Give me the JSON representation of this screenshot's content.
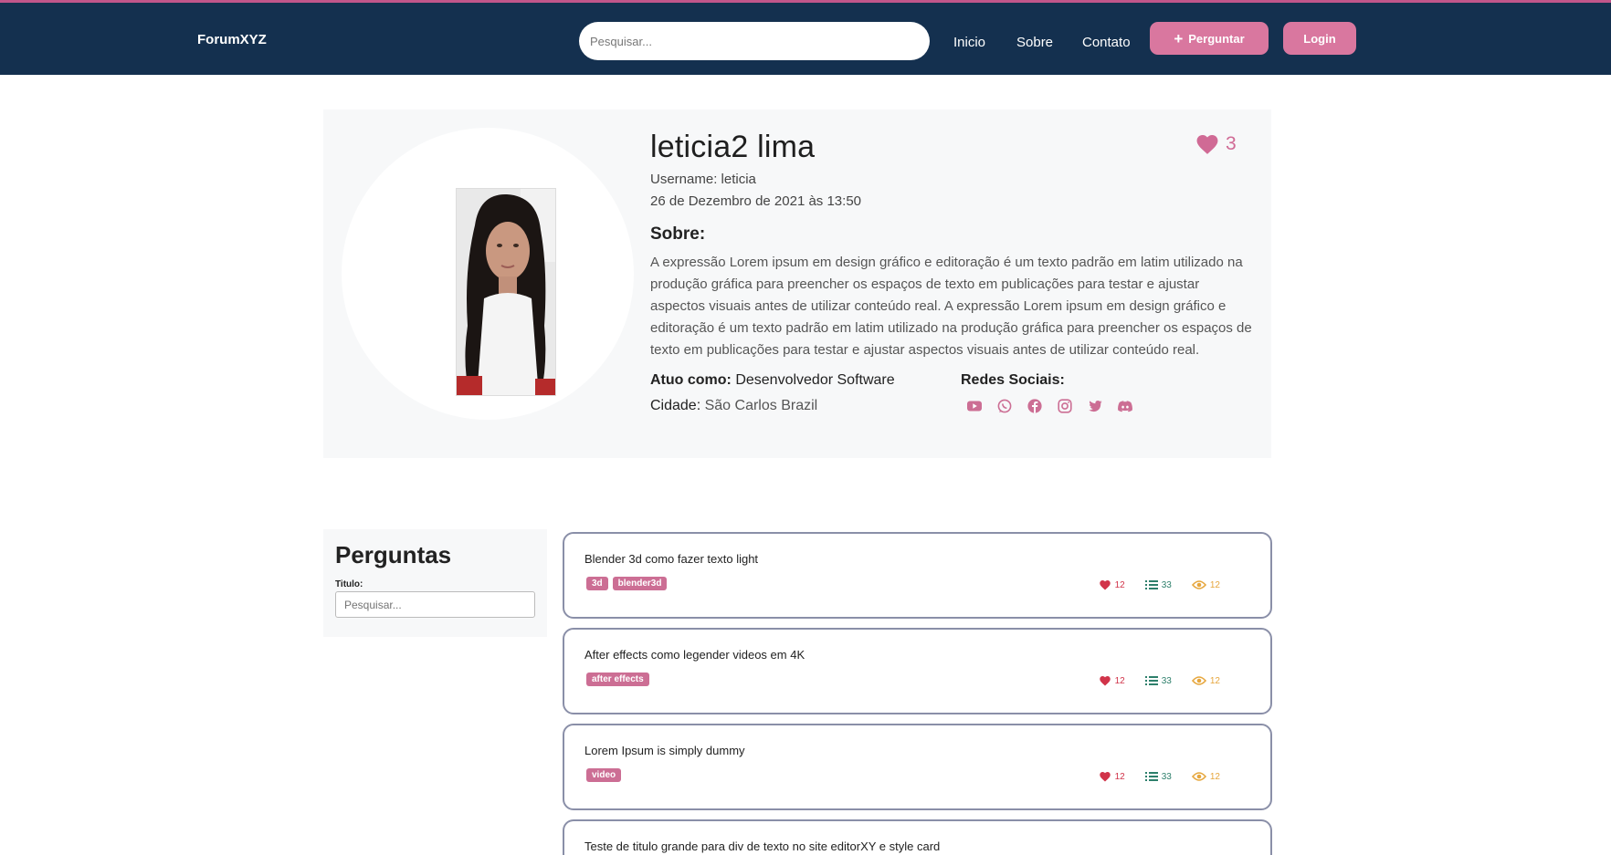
{
  "nav": {
    "brand": "ForumXYZ",
    "search_placeholder": "Pesquisar...",
    "links": [
      "Inicio",
      "Sobre",
      "Contato"
    ],
    "ask_button": "Perguntar",
    "login_button": "Login"
  },
  "profile": {
    "name": "leticia2 lima",
    "username": "Username: leticia",
    "date": "26 de Dezembro de 2021 às 13:50",
    "about_heading": "Sobre:",
    "about_text": "A expressão Lorem ipsum em design gráfico e editoração é um texto padrão em latim utilizado na produção gráfica para preencher os espaços de texto em publicações para testar e ajustar aspectos visuais antes de utilizar conteúdo real. A expressão Lorem ipsum em design gráfico e editoração é um texto padrão em latim utilizado na produção gráfica para preencher os espaços de texto em publicações para testar e ajustar aspectos visuais antes de utilizar conteúdo real.",
    "role_label": "Atuo como:",
    "role_value": "Desenvolvedor Software",
    "city_label": "Cidade:",
    "city_value": "São Carlos Brazil",
    "social_heading": "Redes Sociais:",
    "likes": "3",
    "social_icons": [
      "youtube-icon",
      "whatsapp-icon",
      "facebook-icon",
      "instagram-icon",
      "twitter-icon",
      "discord-icon"
    ]
  },
  "sidebar": {
    "title": "Perguntas",
    "field_label": "Titulo:",
    "search_placeholder": "Pesquisar..."
  },
  "questions": [
    {
      "title": "Blender 3d como fazer texto light",
      "tags": [
        "3d",
        "blender3d"
      ],
      "likes": "12",
      "answers": "33",
      "views": "12"
    },
    {
      "title": "After effects como legender videos em 4K",
      "tags": [
        "after effects"
      ],
      "likes": "12",
      "answers": "33",
      "views": "12"
    },
    {
      "title": "Lorem Ipsum is simply dummy",
      "tags": [
        "video"
      ],
      "likes": "12",
      "answers": "33",
      "views": "12"
    },
    {
      "title": "Teste de titulo grande para div de texto no site editorXY e style card",
      "tags": [],
      "likes": "",
      "answers": "",
      "views": ""
    }
  ],
  "colors": {
    "navbar": "#14304f",
    "accent_pink": "#d9779f",
    "heart_red": "#d1344a",
    "list_green": "#2d7f6b",
    "eye_orange": "#e6a63c"
  }
}
